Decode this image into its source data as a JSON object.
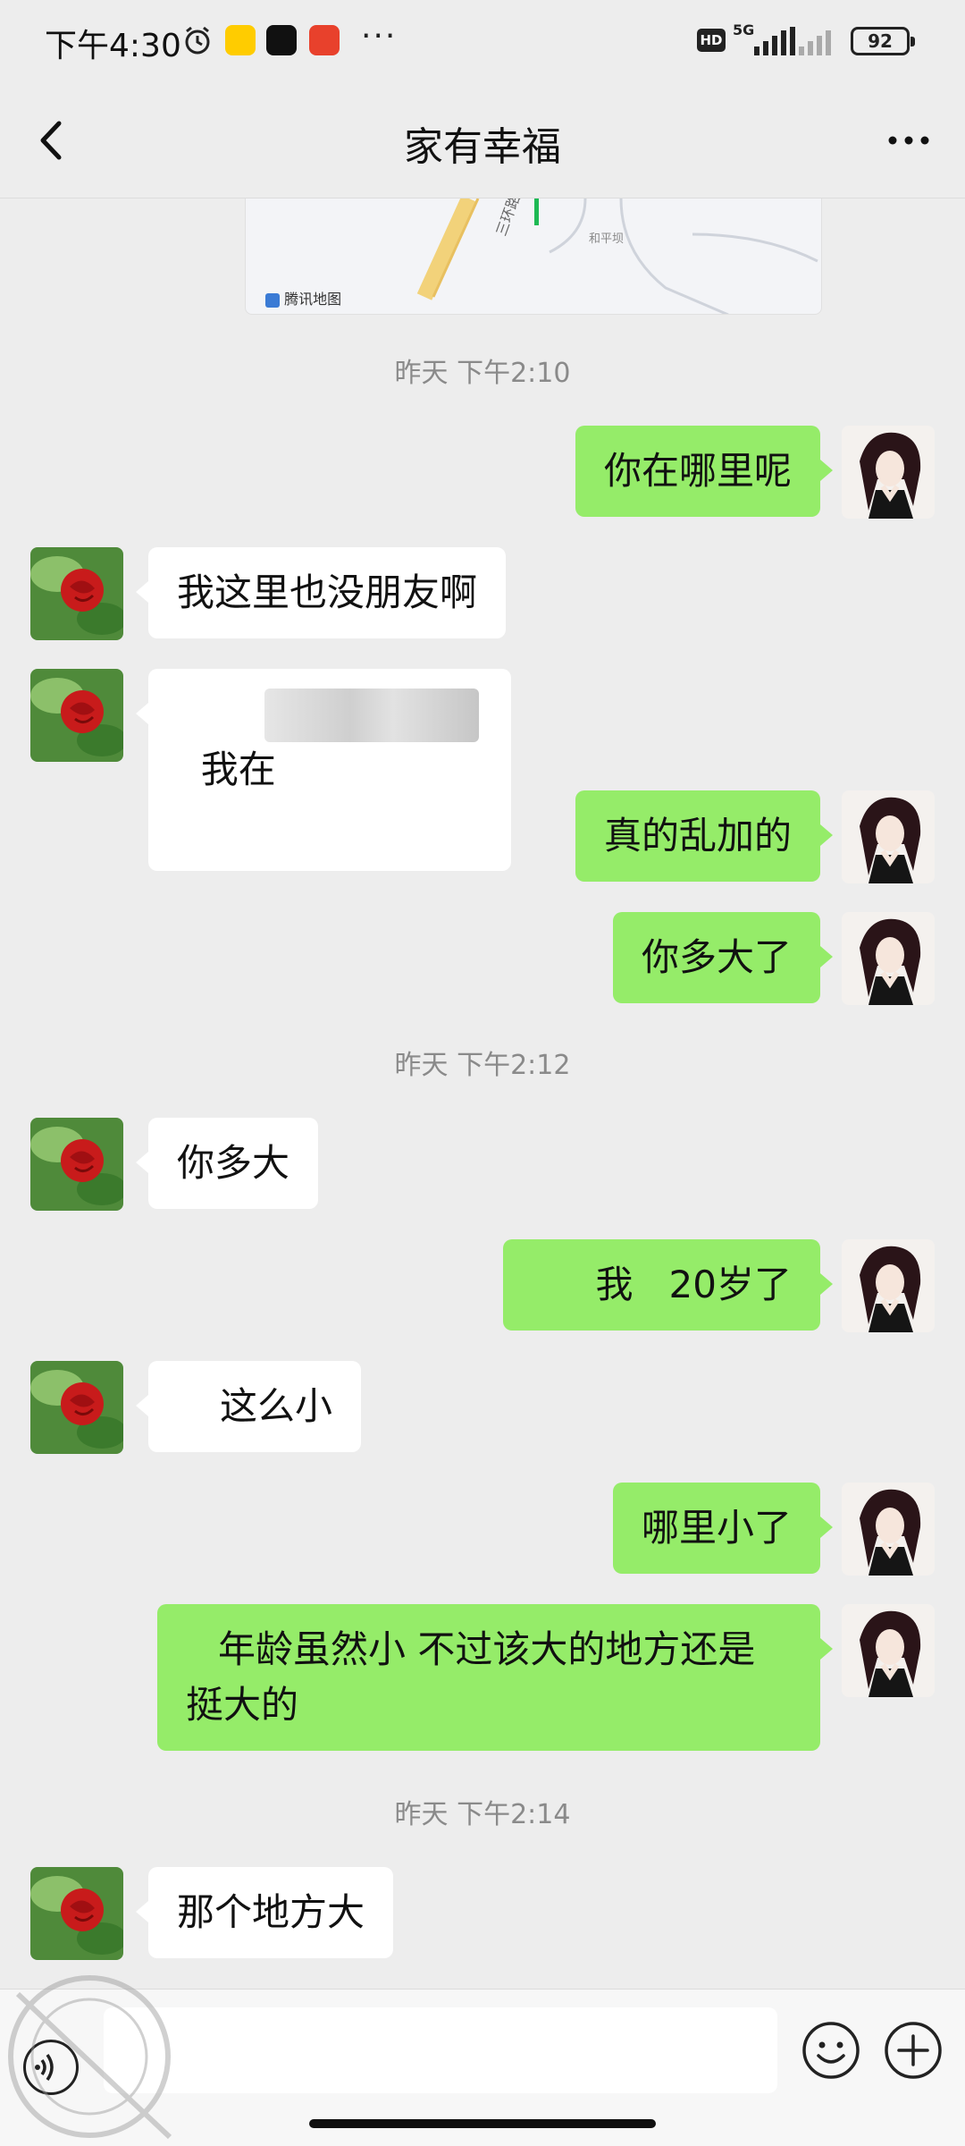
{
  "status_bar": {
    "time": "下午4:30",
    "network": "5G",
    "hd": "HD",
    "battery": "92",
    "more": "···",
    "app_icons": [
      "meituan-icon",
      "douyin-icon",
      "app-icon"
    ]
  },
  "header": {
    "title": "家有幸福",
    "back_icon": "chevron-left-icon",
    "more_icon": "more-dots-icon"
  },
  "map": {
    "attribution": "腾讯地图",
    "labels": [
      "三环路",
      "和平坝"
    ]
  },
  "timestamps": [
    "昨天 下午2:10",
    "昨天 下午2:12",
    "昨天 下午2:14"
  ],
  "messages": [
    {
      "side": "out",
      "text": "你在哪里呢"
    },
    {
      "side": "in",
      "text": "我这里也没朋友啊"
    },
    {
      "side": "in",
      "text": "我在",
      "blurred": true
    },
    {
      "side": "out",
      "text": "真的乱加的"
    },
    {
      "side": "out",
      "text": "你多大了"
    },
    {
      "side": "in",
      "text": "你多大"
    },
    {
      "side": "out",
      "text": "我   20岁了"
    },
    {
      "side": "in",
      "text": "这么小"
    },
    {
      "side": "out",
      "text": "哪里小了"
    },
    {
      "side": "out",
      "text": "年龄虽然小 不过该大的地方还是挺大的"
    },
    {
      "side": "in",
      "text": "那个地方大"
    }
  ],
  "input_bar": {
    "voice_icon": "voice-icon",
    "emoji_icon": "emoji-icon",
    "plus_icon": "plus-icon",
    "placeholder": ""
  },
  "colors": {
    "background": "#ededed",
    "outgoing_bubble": "#95ec69",
    "incoming_bubble": "#ffffff"
  }
}
